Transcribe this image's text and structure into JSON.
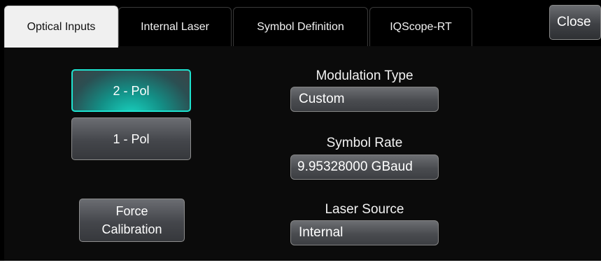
{
  "tabs": [
    {
      "label": "Optical Inputs",
      "active": true
    },
    {
      "label": "Internal Laser",
      "active": false
    },
    {
      "label": "Symbol Definition",
      "active": false
    },
    {
      "label": "IQScope-RT",
      "active": false
    }
  ],
  "close_label": "Close",
  "polarization": {
    "options": [
      "2 - Pol",
      "1 - Pol"
    ],
    "selected": "2 - Pol"
  },
  "force_calibration": {
    "line1": "Force",
    "line2": "Calibration"
  },
  "modulation_type": {
    "label": "Modulation Type",
    "value": "Custom"
  },
  "symbol_rate": {
    "label": "Symbol Rate",
    "value": "9.95328000 GBaud"
  },
  "laser_source": {
    "label": "Laser Source",
    "value": "Internal"
  },
  "colors": {
    "background": "#000000",
    "selected_accent": "#1ee3cf",
    "button_gray": "#4a4c50"
  }
}
